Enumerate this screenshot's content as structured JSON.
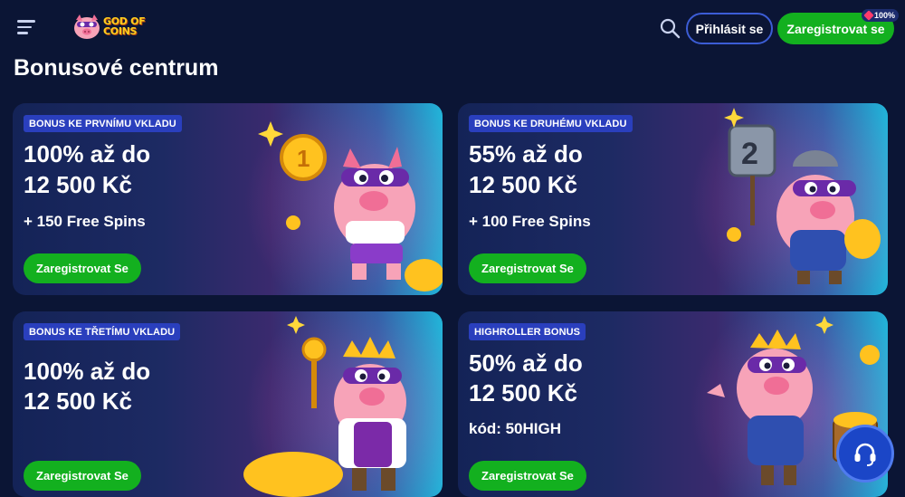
{
  "header": {
    "logo_line1": "GOD OF",
    "logo_line2": "COINS",
    "login_label": "Přihlásit se",
    "register_label": "Zaregistrovat se",
    "badge_label": "100%",
    "icons": [
      "menu-icon",
      "search-icon",
      "gem-icon"
    ]
  },
  "page_title": "Bonusové centrum",
  "cards": [
    {
      "tag": "BONUS KE PRVNÍMU VKLADU",
      "amount_line1": "100% až do",
      "amount_line2": "12 500 Kč",
      "extra": "+ 150 Free Spins",
      "button": "Zaregistrovat Se"
    },
    {
      "tag": "BONUS KE DRUHÉMU VKLADU",
      "amount_line1": "55% až do",
      "amount_line2": "12 500 Kč",
      "extra": "+ 100 Free Spins",
      "button": "Zaregistrovat Se"
    },
    {
      "tag": "BONUS KE TŘETÍMU VKLADU",
      "amount_line1": "100% až do",
      "amount_line2": "12 500 Kč",
      "button": "Zaregistrovat Se"
    },
    {
      "tag": "HIGHROLLER BONUS",
      "amount_line1": "50% až do",
      "amount_line2": "12 500 Kč",
      "extra": "kód: 50HIGH",
      "button": "Zaregistrovat Se"
    }
  ],
  "colors": {
    "background": "#0b1535",
    "accent_green": "#13b01f",
    "tag_blue": "#2a3fbd",
    "logo_yellow": "#ffce1f",
    "chat_blue": "#1b46c7"
  }
}
